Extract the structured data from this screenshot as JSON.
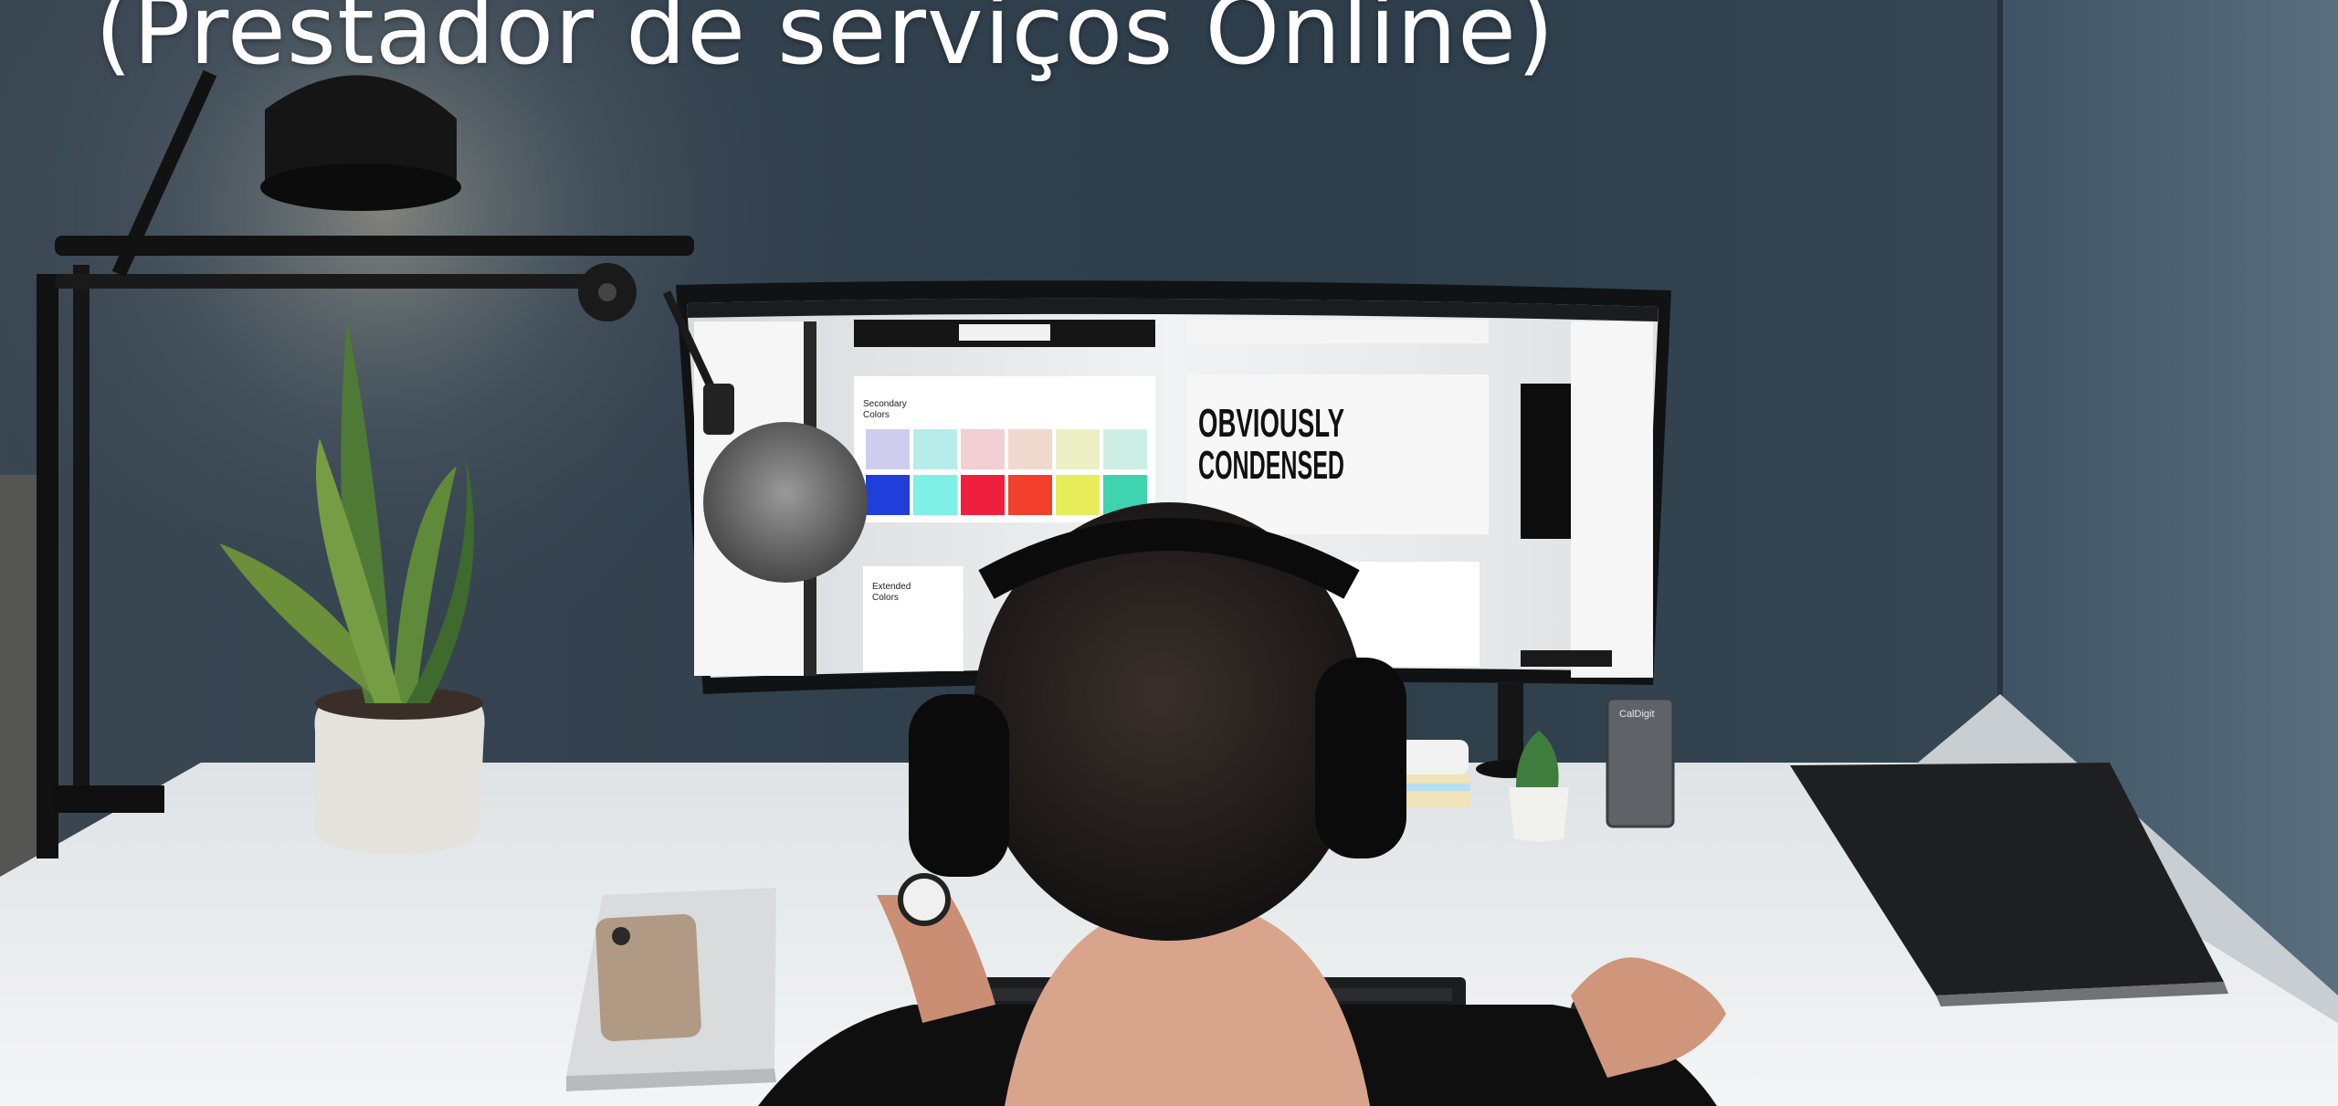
{
  "headline": "(Prestador de serviços Online)",
  "monitor_screen": {
    "big_type_line1": "OBVIOUSLY",
    "big_type_line2": "CONDENSED",
    "panel_secondary_line1": "Secondary",
    "panel_secondary_line2": "Colors",
    "panel_extended_line1": "Extended",
    "panel_extended_line2": "Colors",
    "swatches_top": [
      "#cfcdee",
      "#b8ecea",
      "#f1cfd3",
      "#efd9cf",
      "#ecefc4",
      "#cdeee5"
    ],
    "swatches_bottom": [
      "#1f3fd8",
      "#7ff0e6",
      "#ef1f3d",
      "#f3402c",
      "#e6ec5a",
      "#3fd4b0"
    ]
  },
  "dock_label": "CalDigit",
  "colors": {
    "wall": "#34434f",
    "desk": "#e9eced",
    "text": "#ffffff"
  }
}
